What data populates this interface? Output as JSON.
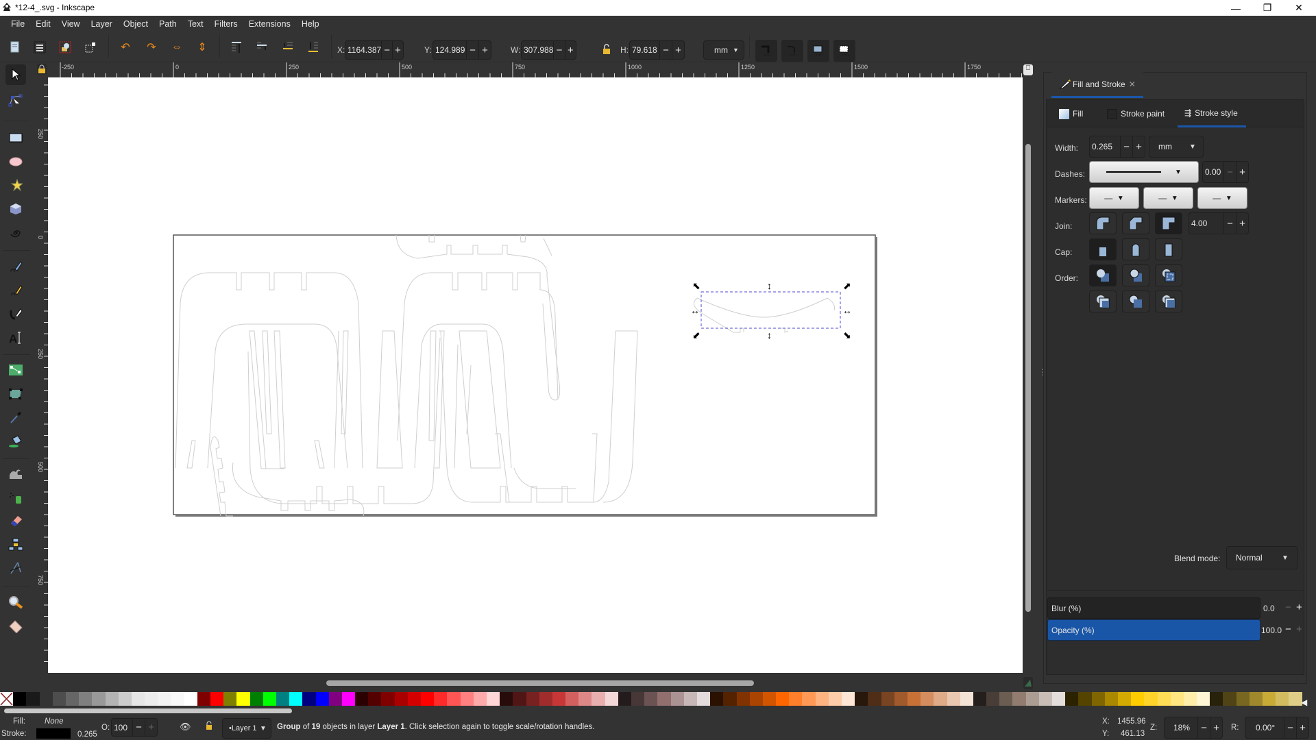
{
  "window": {
    "title": "*12-4_.svg - Inkscape",
    "controls": {
      "minimize": "—",
      "restore": "❐",
      "close": "✕"
    }
  },
  "menubar": [
    "File",
    "Edit",
    "View",
    "Layer",
    "Object",
    "Path",
    "Text",
    "Filters",
    "Extensions",
    "Help"
  ],
  "toolbar": {
    "icons": [
      "select-all-in-layer-icon",
      "select-all-in-all-layers-icon",
      "deselect-icon",
      "select-same-icon",
      "rotate-ccw-icon",
      "rotate-cw-icon",
      "flip-horizontal-icon",
      "flip-vertical-icon",
      "raise-to-top-icon",
      "raise-icon",
      "lower-icon",
      "lower-to-bottom-icon"
    ],
    "x_label": "X:",
    "x_value": "1164.387",
    "y_label": "Y:",
    "y_value": "124.989",
    "w_label": "W:",
    "w_value": "307.988",
    "h_label": "H:",
    "h_value": "79.618",
    "unit": "mm",
    "lock_icon": "lock-open-icon",
    "transform_toggles": [
      "scale-stroke-icon",
      "scale-corners-icon",
      "move-gradients-icon",
      "move-patterns-icon"
    ]
  },
  "rulers": {
    "horizontal_labels": [
      "-250",
      "0",
      "250",
      "500",
      "750",
      "1000",
      "1250",
      "1500",
      "1750"
    ],
    "vertical_labels": [
      "250",
      "0",
      "250",
      "500",
      "750"
    ]
  },
  "tools": [
    {
      "name": "selector-tool",
      "icon": "arrow-icon",
      "active": true
    },
    {
      "name": "node-tool",
      "icon": "node-icon"
    },
    {
      "name": "rectangle-tool",
      "icon": "rectangle-icon"
    },
    {
      "name": "ellipse-tool",
      "icon": "ellipse-icon"
    },
    {
      "name": "star-tool",
      "icon": "star-icon"
    },
    {
      "name": "3d-box-tool",
      "icon": "cube-icon"
    },
    {
      "name": "spiral-tool",
      "icon": "spiral-icon"
    },
    {
      "name": "bezier-tool",
      "icon": "pen-icon"
    },
    {
      "name": "pencil-tool",
      "icon": "pencil-icon"
    },
    {
      "name": "calligraphy-tool",
      "icon": "calligraphy-icon"
    },
    {
      "name": "text-tool",
      "icon": "text-icon"
    },
    {
      "name": "gradient-tool",
      "icon": "gradient-icon"
    },
    {
      "name": "mesh-tool",
      "icon": "mesh-icon"
    },
    {
      "name": "dropper-tool",
      "icon": "dropper-icon"
    },
    {
      "name": "paint-bucket-tool",
      "icon": "bucket-icon"
    },
    {
      "name": "tweak-tool",
      "icon": "tweak-icon"
    },
    {
      "name": "spray-tool",
      "icon": "spray-icon"
    },
    {
      "name": "eraser-tool",
      "icon": "eraser-icon"
    },
    {
      "name": "connector-tool",
      "icon": "connector-icon"
    },
    {
      "name": "lpe-tool",
      "icon": "compass-icon"
    },
    {
      "name": "zoom-tool",
      "icon": "magnifier-icon"
    },
    {
      "name": "measure-tool",
      "icon": "ruler-icon"
    }
  ],
  "canvas": {
    "selection_info": "Group of 19 objects"
  },
  "dock": {
    "tab_label": "Fill and Stroke",
    "subtabs": [
      {
        "label": "Fill",
        "icon": "fill-swatch-icon"
      },
      {
        "label": "Stroke paint",
        "icon": "stroke-paint-swatch-icon"
      },
      {
        "label": "Stroke style",
        "icon": "stroke-style-icon",
        "active": true
      }
    ],
    "width_label": "Width:",
    "width_value": "0.265",
    "width_unit": "mm",
    "dashes_label": "Dashes:",
    "dash_offset": "0.00",
    "markers_label": "Markers:",
    "join_label": "Join:",
    "miter_limit": "4.00",
    "join_options": [
      "round-join",
      "bevel-join",
      "miter-join"
    ],
    "join_selected": "miter-join",
    "cap_label": "Cap:",
    "cap_options": [
      "butt-cap",
      "round-cap",
      "square-cap"
    ],
    "cap_selected": "butt-cap",
    "order_label": "Order:",
    "order_options": [
      "fill-stroke-markers",
      "stroke-fill-markers",
      "fill-markers-stroke",
      "markers-fill-stroke",
      "stroke-markers-fill",
      "markers-stroke-fill"
    ],
    "order_selected": "fill-stroke-markers",
    "blend_label": "Blend mode:",
    "blend_value": "Normal",
    "blur_label": "Blur (%)",
    "blur_value": "0.0",
    "opacity_label": "Opacity (%)",
    "opacity_value": "100.0"
  },
  "palette": [
    "none",
    "#000000",
    "#1a1a1a",
    "#333333",
    "#4d4d4d",
    "#666666",
    "#808080",
    "#999999",
    "#b3b3b3",
    "#cccccc",
    "#e6e6e6",
    "#ececec",
    "#f2f2f2",
    "#f8f8f8",
    "#ffffff",
    "#800000",
    "#ff0000",
    "#808000",
    "#ffff00",
    "#008000",
    "#00ff00",
    "#008080",
    "#00ffff",
    "#000080",
    "#0000ff",
    "#800080",
    "#ff00ff",
    "#2b0000",
    "#550000",
    "#800000",
    "#aa0000",
    "#d40000",
    "#ff0000",
    "#ff2a2a",
    "#ff5555",
    "#ff8080",
    "#ffaaaa",
    "#ffd5d5",
    "#280b0b",
    "#501616",
    "#782121",
    "#a02c2c",
    "#c83737",
    "#d35f5f",
    "#de8787",
    "#e9afaf",
    "#f4d7d7",
    "#241c1c",
    "#483737",
    "#6c5353",
    "#916f6f",
    "#ac9393",
    "#c8b7b7",
    "#e3dbdb",
    "#2b1100",
    "#552200",
    "#803300",
    "#aa4400",
    "#d45500",
    "#ff6600",
    "#ff7f2a",
    "#ff9955",
    "#ffb380",
    "#ffccaa",
    "#ffe6d5",
    "#28170b",
    "#502d16",
    "#784421",
    "#a05a2c",
    "#c87137",
    "#d38d5f",
    "#deaa87",
    "#e9c6af",
    "#f4e3d7",
    "#241f1c",
    "#483e37",
    "#6c5d53",
    "#917c6f",
    "#ac9d93",
    "#c8beb7",
    "#e3dedb",
    "#2b2200",
    "#554400",
    "#806600",
    "#aa8800",
    "#d4aa00",
    "#ffcc00",
    "#ffd42a",
    "#ffdd55",
    "#ffe680",
    "#ffeeaa",
    "#fff6d5",
    "#28220b",
    "#504416",
    "#786721",
    "#a0892c",
    "#c8ab37",
    "#d3bc5f",
    "#decd87"
  ],
  "status": {
    "fill_label": "Fill:",
    "fill_value": "None",
    "stroke_label": "Stroke:",
    "stroke_width": "0.265",
    "stroke_color": "#000000",
    "opacity_label": "O:",
    "opacity_value": "100",
    "layer": "•Layer 1",
    "message_bold1": "Group",
    "message_part1": " of ",
    "message_bold2": "19",
    "message_part2": " objects in layer ",
    "message_bold3": "Layer 1",
    "message_part3": ". Click selection again to toggle scale/rotation handles.",
    "cursor_x_label": "X:",
    "cursor_x": "1455.96",
    "cursor_y_label": "Y:",
    "cursor_y": "461.13",
    "zoom_label": "Z:",
    "zoom_value": "18%",
    "rotation_label": "R:",
    "rotation_value": "0.00°"
  }
}
